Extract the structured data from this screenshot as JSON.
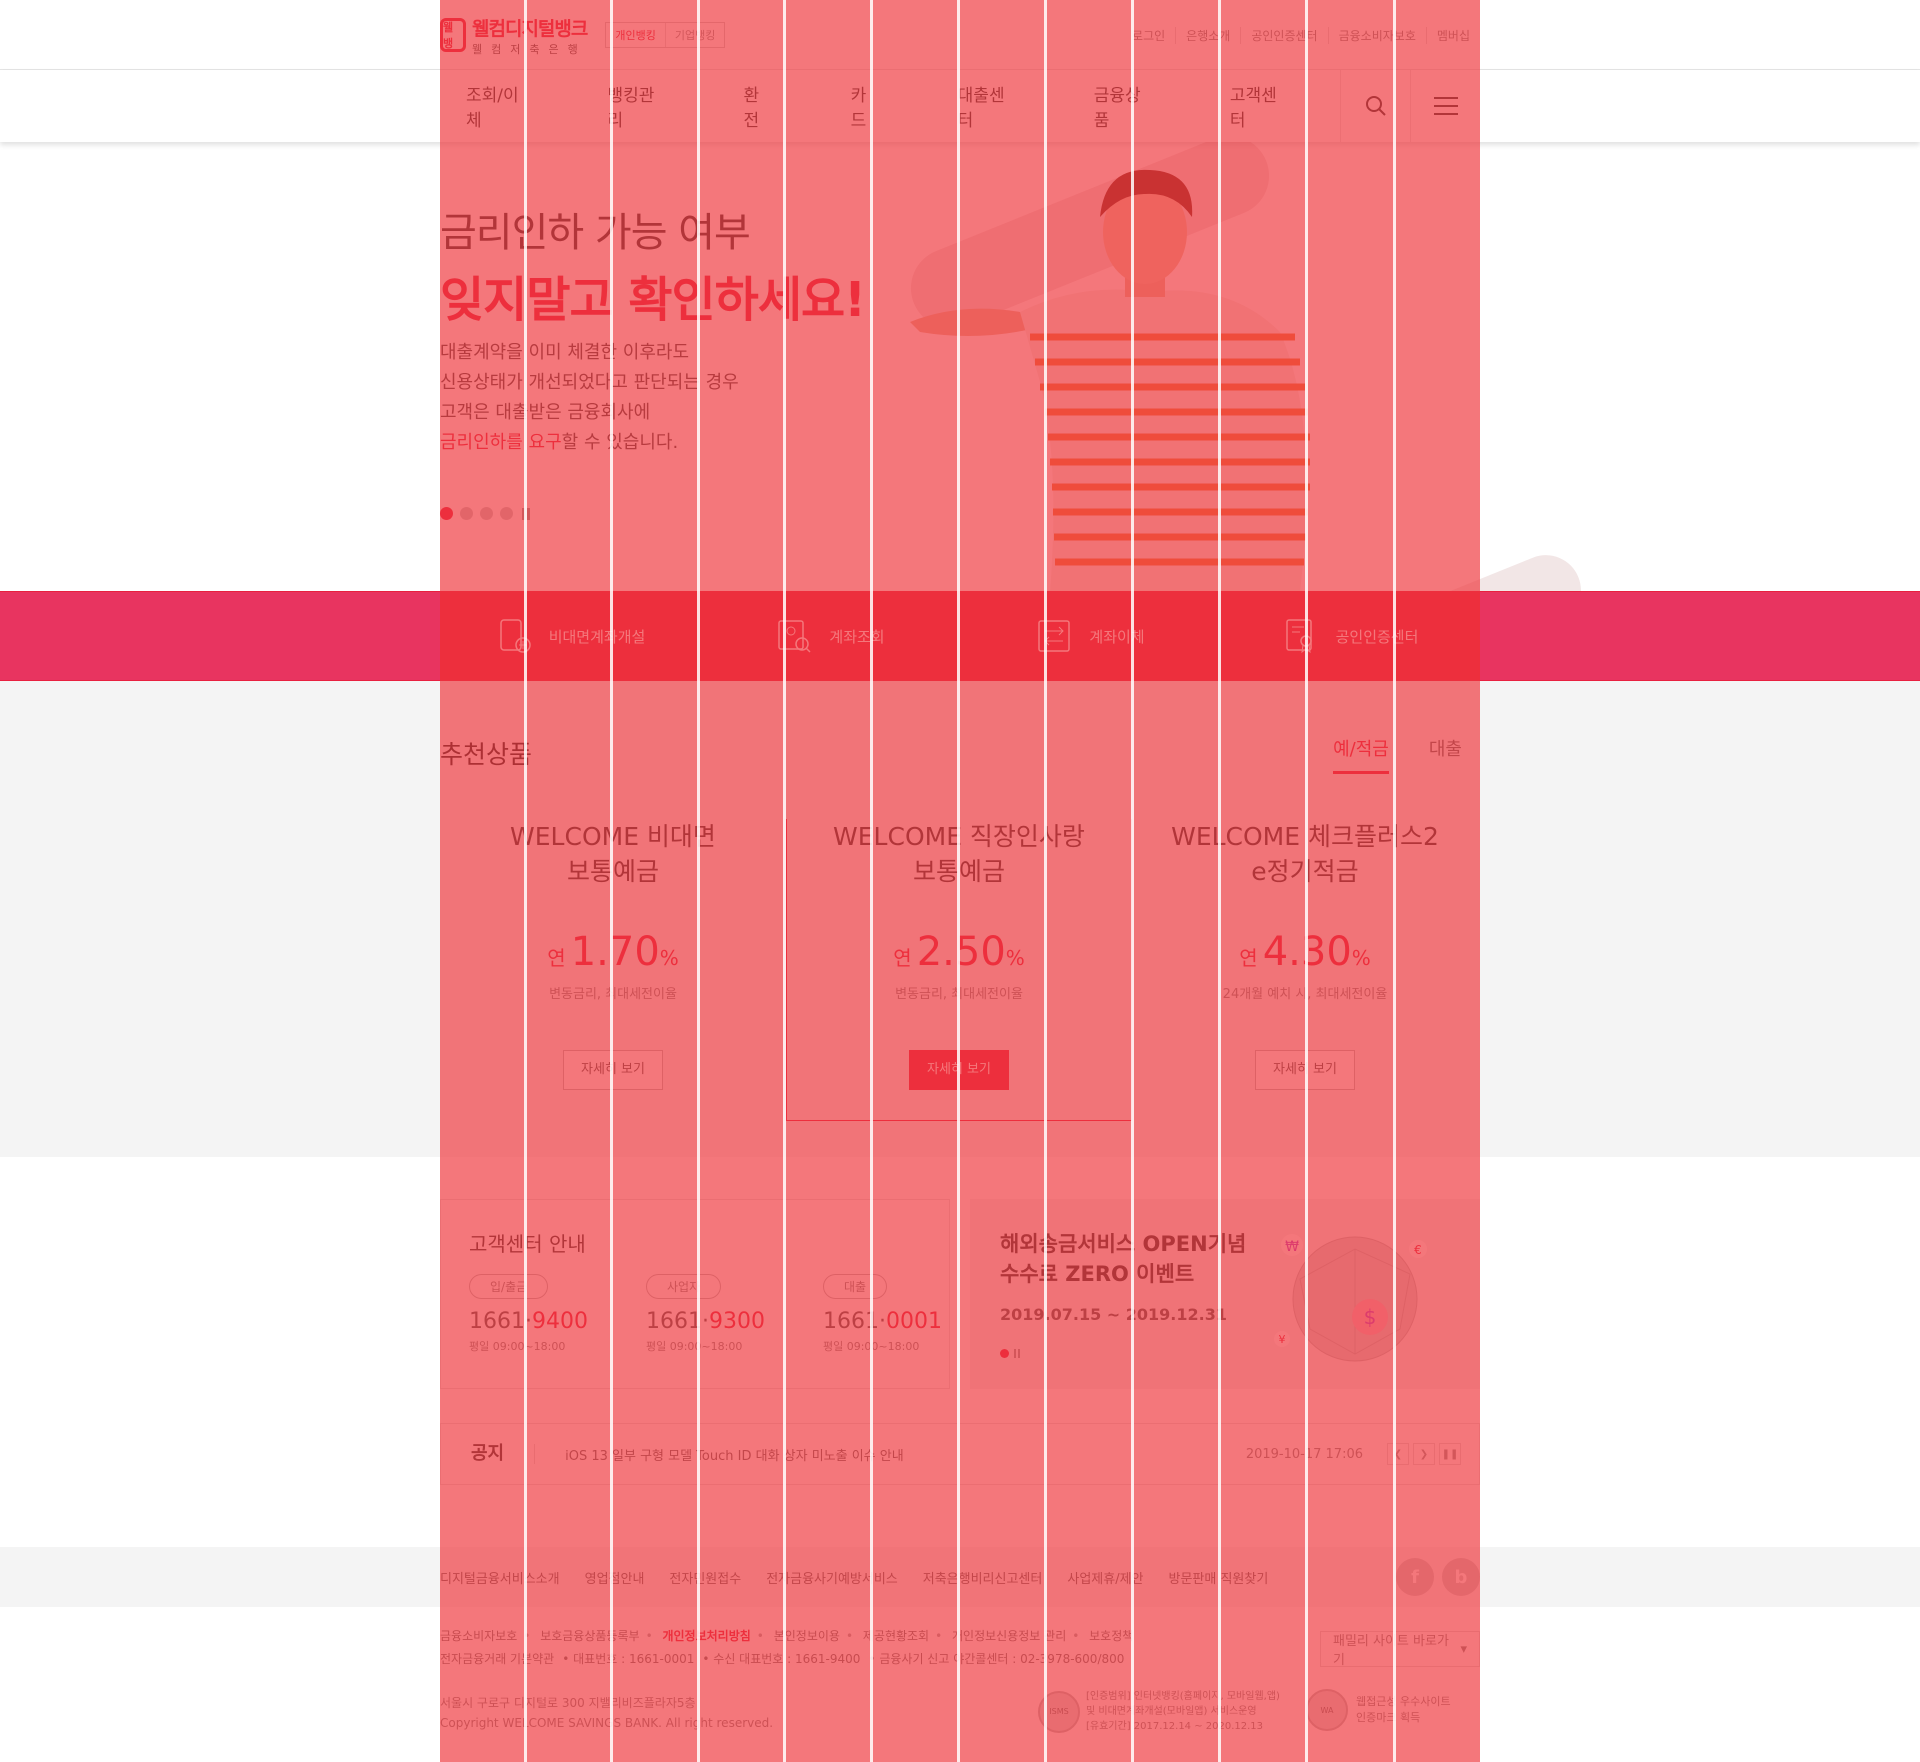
{
  "logo": {
    "mark": "웰뱅",
    "main": "웰컴디지털뱅크",
    "sub": "웰컴저축은행"
  },
  "bank_tabs": [
    "개인뱅킹",
    "기업뱅킹"
  ],
  "util_links": [
    "로그인",
    "은행소개",
    "공인인증센터",
    "금융소비자보호",
    "멤버십"
  ],
  "gnb": [
    "조회/이체",
    "뱅킹관리",
    "환전",
    "카드",
    "대출센터",
    "금융상품",
    "고객센터"
  ],
  "gnb_tools": {
    "search": "search-icon",
    "menu": "hamburger-icon"
  },
  "hero": {
    "line1": "금리인하 가능 여부",
    "line2": "잊지말고 확인하세요!",
    "desc1": "대출계약을 이미 체결한 이후라도",
    "desc2": "신용상태가 개선되었다고 판단되는 경우",
    "desc3": "고객은 대출받은 금융회사에",
    "desc4_hl": "금리인하를 요구",
    "desc4_rest": "할 수 있습니다."
  },
  "quick": [
    "비대면계좌개설",
    "계좌조회",
    "계좌이체",
    "공인인증센터"
  ],
  "recommend": {
    "title": "추천상품",
    "tabs": [
      "예/적금",
      "대출"
    ],
    "cards": [
      {
        "name": "WELCOME 비대면\n보통예금",
        "pre": "연",
        "rate": "1.70",
        "pct": "%",
        "note": "변동금리, 최대세전이율",
        "btn": "자세히 보기"
      },
      {
        "name": "WELCOME 직장인사랑\n보통예금",
        "pre": "연",
        "rate": "2.50",
        "pct": "%",
        "note": "변동금리, 최대세전이율",
        "btn": "자세히 보기"
      },
      {
        "name": "WELCOME 체크플러스2\ne정기적금",
        "pre": "연",
        "rate": "4.30",
        "pct": "%",
        "note": "24개월 예치 시, 최대세전이율",
        "btn": "자세히 보기"
      }
    ]
  },
  "cs": {
    "title": "고객센터 안내",
    "items": [
      {
        "badge": "입/출금",
        "pre": "1661·",
        "num": "9400",
        "hours": "평일 09:00~18:00"
      },
      {
        "badge": "사업자",
        "pre": "1661·",
        "num": "9300",
        "hours": "평일 09:00~18:00"
      },
      {
        "badge": "대출",
        "pre": "1661·",
        "num": "0001",
        "hours": "평일 09:00~18:00"
      }
    ]
  },
  "event": {
    "title": "해외송금서비스 OPEN기념\n수수료 ZERO 이벤트",
    "date": "2019.07.15 ~ 2019.12.31"
  },
  "notice": {
    "label": "공지",
    "text": "iOS 13 일부 구형 모델 Touch ID 대화 상자 미노출 이슈 안내",
    "date": "2019-10-17 17:06"
  },
  "footer_links": [
    "디지털금융서비스소개",
    "영업점안내",
    "전자민원접수",
    "전자금융사기예방서비스",
    "저축은행비리신고센터",
    "사업제휴/제안",
    "방문판매 직원찾기"
  ],
  "footer_policy": [
    "금융소비자보호",
    "보호금융상품등록부",
    "개인정보처리방침",
    "본인정보이용",
    "제공현황조회",
    "개인정보신용정보 관리",
    "보호정책"
  ],
  "footer_policy2": [
    "전자금융거래 기본약관",
    "대표번호 : 1661-0001",
    "수신 대표번호 : 1661-9400",
    "금융사기 신고 야간콜센터 : 02-3978-600/800"
  ],
  "address": "서울시 구로구 디지털로 300 지밸리비즈플라자5층",
  "copyright": "Copyright WELCOME SAVINGS BANK. All right reserved.",
  "family_site": "패밀리 사이트 바로가기",
  "cert1_text": "[인증범위] 인터넷뱅킹(홈페이지, 모바일웹,앱)\n및 비대면계좌개설(모바일앱) 서비스운영\n[유효기간] 2017.12.14 ~ 2020.12.13",
  "cert2_text": "웹접근성 우수사이트\n인증마크 획득",
  "colors": {
    "brand": "#e8203f",
    "overlay": "#ef373c"
  }
}
